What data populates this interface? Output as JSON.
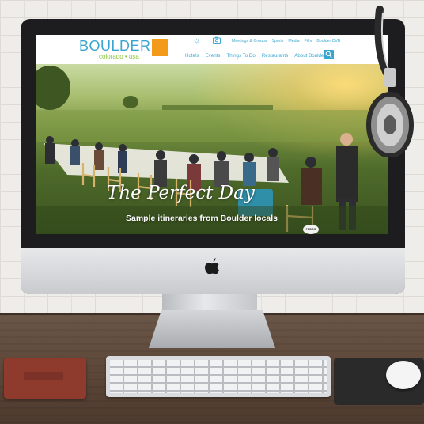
{
  "site": {
    "logo_word": "BOULDER",
    "logo_sub": "colorado • usa",
    "util_nav": [
      "Meetings & Groups",
      "Sports",
      "Media",
      "Film",
      "Boulder CVB"
    ],
    "main_nav": [
      "Hotels",
      "Events",
      "Things To Do",
      "Restaurants",
      "About Boulder"
    ],
    "icons": {
      "weather": "sun-icon",
      "camera": "camera-icon",
      "search": "search-icon"
    },
    "colors": {
      "brand_blue": "#3aa6cf",
      "brand_green": "#8cc63e",
      "brand_orange": "#f39a1b"
    }
  },
  "hero": {
    "title": "The Perfect Day",
    "subtitle": "Sample itineraries from Boulder locals",
    "badge": "PEDCO"
  },
  "scene": {
    "device": "desktop-monitor",
    "brand_icon": "apple-logo-icon",
    "props": [
      "headphones",
      "notebook",
      "keyboard",
      "mouse",
      "mousepad"
    ]
  }
}
